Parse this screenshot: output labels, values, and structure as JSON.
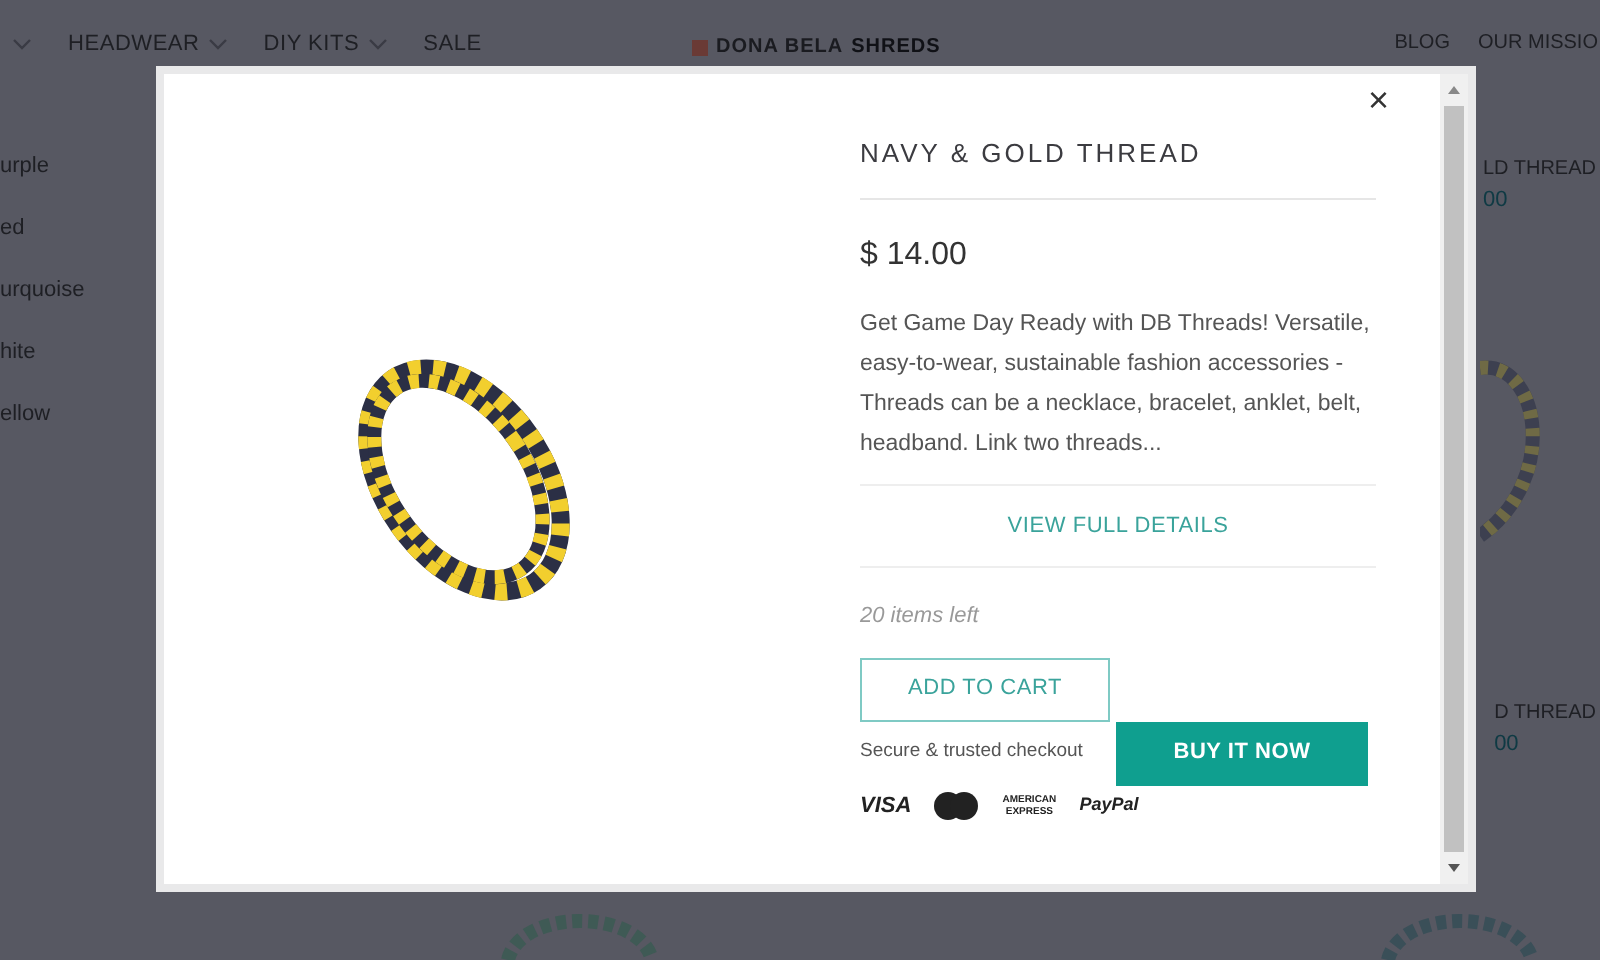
{
  "background_page": {
    "nav_left": [
      {
        "label": "HEADWEAR",
        "dropdown": true
      },
      {
        "label": "DIY KITS",
        "dropdown": true
      },
      {
        "label": "SALE",
        "dropdown": false
      }
    ],
    "logo": {
      "prefix": "DONA BELA",
      "suffix": "SHREDS"
    },
    "nav_right": [
      "BLOG",
      "OUR MISSIO"
    ],
    "color_filters": [
      "urple",
      "ed",
      "urquoise",
      "hite",
      "ellow"
    ],
    "products": [
      {
        "title": "LD THREAD",
        "price": "00"
      },
      {
        "title": "D THREAD",
        "price": "00"
      }
    ]
  },
  "modal": {
    "close": "×",
    "title": "NAVY & GOLD THREAD",
    "price": "$ 14.00",
    "description": "Get Game Day Ready with DB Threads! Versatile, easy-to-wear, sustainable fashion accessories - Threads can be a necklace, bracelet, anklet, belt, headband. Link two threads...",
    "details_link": "VIEW FULL DETAILS",
    "stock": "20 items left",
    "add_to_cart": "ADD TO CART",
    "secure_text": "Secure & trusted checkout",
    "buy_now": "BUY IT NOW",
    "payment_logos": [
      {
        "kind": "text",
        "label": "VISA"
      },
      {
        "kind": "mastercard"
      },
      {
        "kind": "amex",
        "label": "AMERICAN EXPRESS"
      },
      {
        "kind": "paypal",
        "label": "PayPal"
      }
    ]
  }
}
